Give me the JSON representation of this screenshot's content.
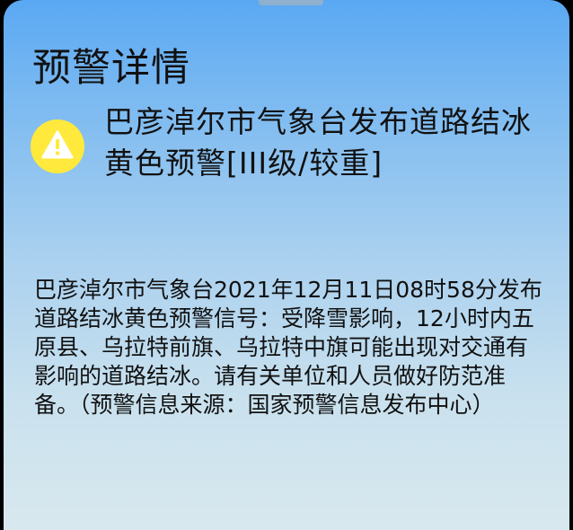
{
  "colors": {
    "icon_fill": "#ffe93d",
    "icon_symbol": "#ffffff",
    "text": "#111111"
  },
  "detail": {
    "title": "预警详情",
    "icon": "warning-triangle-icon",
    "headline": "巴彦淖尔市气象台发布道路结冰黄色预警[III级/较重]",
    "body": "巴彦淖尔市气象台2021年12月11日08时58分发布道路结冰黄色预警信号：受降雪影响，12小时内五原县、乌拉特前旗、乌拉特中旗可能出现对交通有影响的道路结冰。请有关单位和人员做好防范准备。",
    "source": "（预警信息来源：国家预警信息发布中心）"
  }
}
